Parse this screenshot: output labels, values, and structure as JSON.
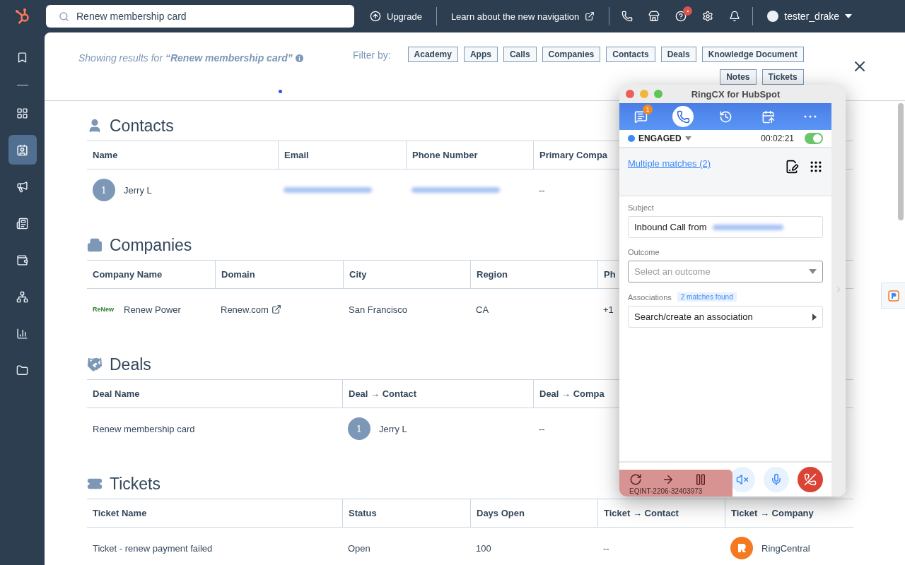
{
  "topbar": {
    "search_value": "Renew membership card",
    "upgrade": "Upgrade",
    "learn_link": "Learn about the new navigation",
    "help_badge": "•",
    "user": "tester_drake"
  },
  "sidebar": {
    "pinned": [
      {
        "kind": "bookmark",
        "selected": false
      }
    ],
    "items": [
      {
        "kind": "grid",
        "selected": false
      },
      {
        "kind": "contacts",
        "selected": true
      },
      {
        "kind": "megaphone",
        "selected": false
      },
      {
        "kind": "document",
        "selected": false
      },
      {
        "kind": "wallet",
        "selected": false
      },
      {
        "kind": "network",
        "selected": false
      },
      {
        "kind": "chart",
        "selected": false
      },
      {
        "kind": "folder",
        "selected": false
      }
    ]
  },
  "results": {
    "prefix": "Showing results for",
    "query": "“Renew membership card”",
    "filter_label": "Filter by:",
    "filters": [
      "Academy",
      "Apps",
      "Calls",
      "Companies",
      "Contacts",
      "Deals",
      "Knowledge Document",
      "Notes",
      "Tickets"
    ]
  },
  "sections": [
    {
      "kind": "contacts",
      "title": "Contacts",
      "columns": [
        "Name",
        "Email",
        "Phone Number",
        "Primary Compa"
      ],
      "rows": [
        [
          {
            "kind": "avatar",
            "badge": "1",
            "text": "Jerry L"
          },
          {
            "kind": "blurred"
          },
          {
            "kind": "blurred"
          },
          {
            "kind": "text",
            "text": "--"
          }
        ]
      ]
    },
    {
      "kind": "companies",
      "title": "Companies",
      "columns": [
        "Company Name",
        "Domain",
        "City",
        "Region",
        "Ph"
      ],
      "rows": [
        [
          {
            "kind": "logo",
            "logo": "ReNew",
            "text": "Renew Power"
          },
          {
            "kind": "link",
            "text": "Renew.com"
          },
          {
            "kind": "text",
            "text": "San Francisco"
          },
          {
            "kind": "text",
            "text": "CA"
          },
          {
            "kind": "text",
            "text": "+1"
          }
        ]
      ]
    },
    {
      "kind": "deals",
      "title": "Deals",
      "columns": [
        "Deal Name",
        "Deal → Contact",
        "Deal → Compa"
      ],
      "rows": [
        [
          {
            "kind": "text",
            "text": "Renew membership card"
          },
          {
            "kind": "avatar",
            "badge": "1",
            "text": "Jerry L"
          },
          {
            "kind": "text",
            "text": "--"
          }
        ]
      ]
    },
    {
      "kind": "tickets",
      "title": "Tickets",
      "columns": [
        "Ticket Name",
        "Status",
        "Days Open",
        "Ticket → Contact",
        "Ticket → Company"
      ],
      "rows": [
        [
          {
            "kind": "text",
            "text": "Ticket - renew payment failed"
          },
          {
            "kind": "text",
            "text": "Open"
          },
          {
            "kind": "text",
            "text": "100"
          },
          {
            "kind": "text",
            "text": "--"
          },
          {
            "kind": "brand",
            "text": "RingCentral"
          }
        ]
      ]
    }
  ],
  "dialer": {
    "title": "RingCX for HubSpot",
    "nav": [
      {
        "kind": "messages",
        "badge": "1",
        "selected": false
      },
      {
        "kind": "phone",
        "selected": true
      },
      {
        "kind": "history",
        "selected": false
      },
      {
        "kind": "calendar",
        "selected": false
      },
      {
        "kind": "more",
        "selected": false
      }
    ],
    "status": "ENGAGED",
    "timer": "00:02:21",
    "toggle_on": true,
    "matches_link": "Multiple matches (2)",
    "subject_label": "Subject",
    "subject_value": "Inbound Call from",
    "outcome_label": "Outcome",
    "outcome_placeholder": "Select an outcome",
    "associations_label": "Associations",
    "associations_badge": "2 matches found",
    "association_search": "Search/create an association",
    "call_id": "EQINT-2206-32403973"
  }
}
